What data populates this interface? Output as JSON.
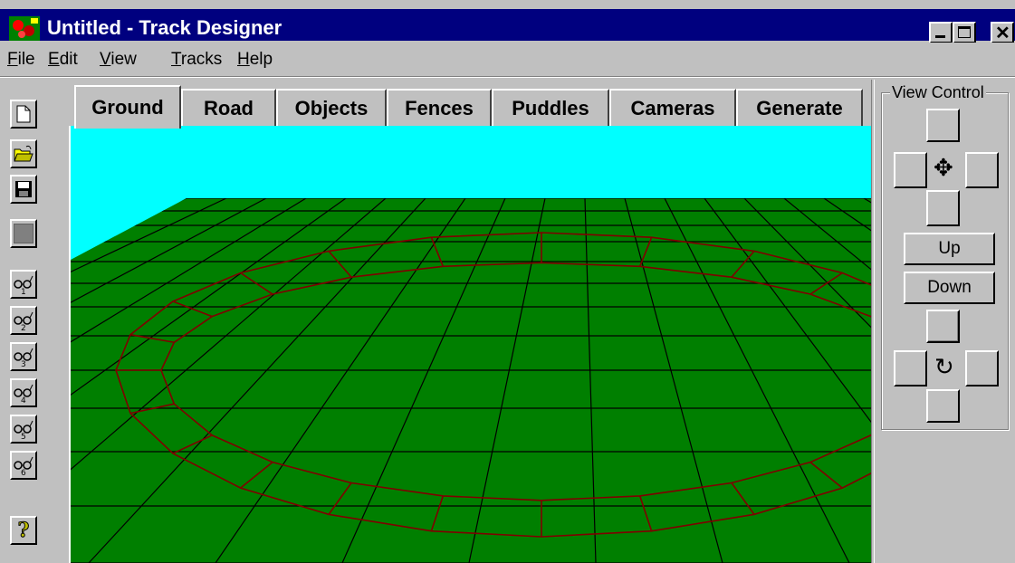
{
  "window": {
    "title": "Untitled - Track Designer",
    "controls": [
      "minimize",
      "maximize",
      "close"
    ]
  },
  "menu": [
    {
      "label": "File",
      "mnemonic": "F",
      "rest": "ile"
    },
    {
      "label": "Edit",
      "mnemonic": "E",
      "rest": "dit"
    },
    {
      "label": "View",
      "mnemonic": "V",
      "rest": "iew"
    },
    {
      "label": "Tracks",
      "mnemonic": "T",
      "rest": "racks"
    },
    {
      "label": "Help",
      "mnemonic": "H",
      "rest": "elp"
    }
  ],
  "toolbar": [
    {
      "icon": "new-document-icon"
    },
    {
      "icon": "open-folder-icon"
    },
    {
      "icon": "save-disk-icon"
    },
    {
      "icon": "blank-icon"
    },
    {
      "icon": "camera-view-1-icon",
      "num": "1"
    },
    {
      "icon": "camera-view-2-icon",
      "num": "2"
    },
    {
      "icon": "camera-view-3-icon",
      "num": "3"
    },
    {
      "icon": "camera-view-4-icon",
      "num": "4"
    },
    {
      "icon": "camera-view-5-icon",
      "num": "5"
    },
    {
      "icon": "camera-view-6-icon",
      "num": "6"
    },
    {
      "icon": "help-question-icon"
    }
  ],
  "tabs": [
    {
      "label": "Ground",
      "active": true
    },
    {
      "label": "Road"
    },
    {
      "label": "Objects"
    },
    {
      "label": "Fences"
    },
    {
      "label": "Puddles"
    },
    {
      "label": "Cameras"
    },
    {
      "label": "Generate"
    }
  ],
  "view_control": {
    "label": "View Control",
    "up_label": "Up",
    "down_label": "Down",
    "move_icon": "move-cross-icon",
    "rotate_icon": "rotate-icon"
  },
  "colors": {
    "sky": "#00ffff",
    "ground": "#007f00",
    "grid": "#000000",
    "track": "#7f0000",
    "title_bar": "#00007f"
  }
}
